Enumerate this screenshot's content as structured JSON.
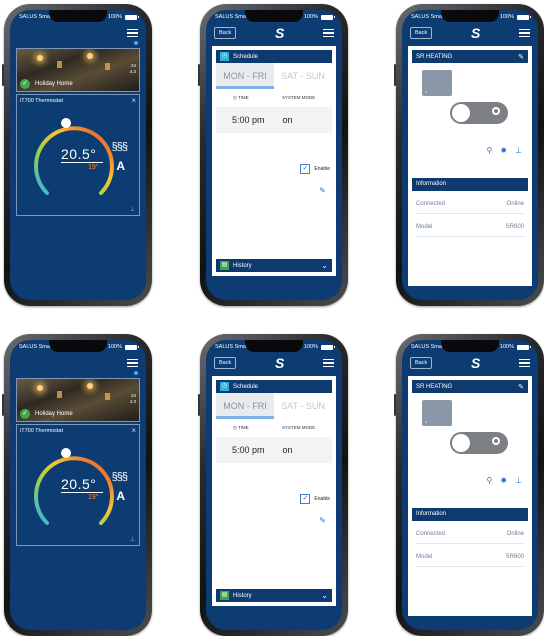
{
  "status": {
    "carrier": "SALUS Smart Home",
    "battery": "100%"
  },
  "nav": {
    "back_label": "Back",
    "logo": "S"
  },
  "home": {
    "house_label": "Holiday Home",
    "house_temp_top": "24",
    "house_temp_bottom": "4.3"
  },
  "thermostat": {
    "title": "iT700 Thermostat",
    "current_temp": "20.5°",
    "set_temp": "19°",
    "mode_glyph": "A"
  },
  "schedule": {
    "title": "Schedule",
    "tabs": [
      "MON - FRI",
      "SAT - SUN"
    ],
    "columns": [
      "TIME",
      "SYSTEM MODE"
    ],
    "time": "5:00 pm",
    "mode": "on",
    "enable_label": "Enable",
    "history_label": "History"
  },
  "device": {
    "title": "SR HEATING",
    "info_label": "Information",
    "rows": [
      {
        "label": "Connected",
        "value": "Online"
      },
      {
        "label": "Model",
        "value": "SR600"
      }
    ]
  },
  "colors": {
    "primary": "#0d3c73",
    "accent": "#2ab3d7",
    "header": "#0f3a70"
  }
}
